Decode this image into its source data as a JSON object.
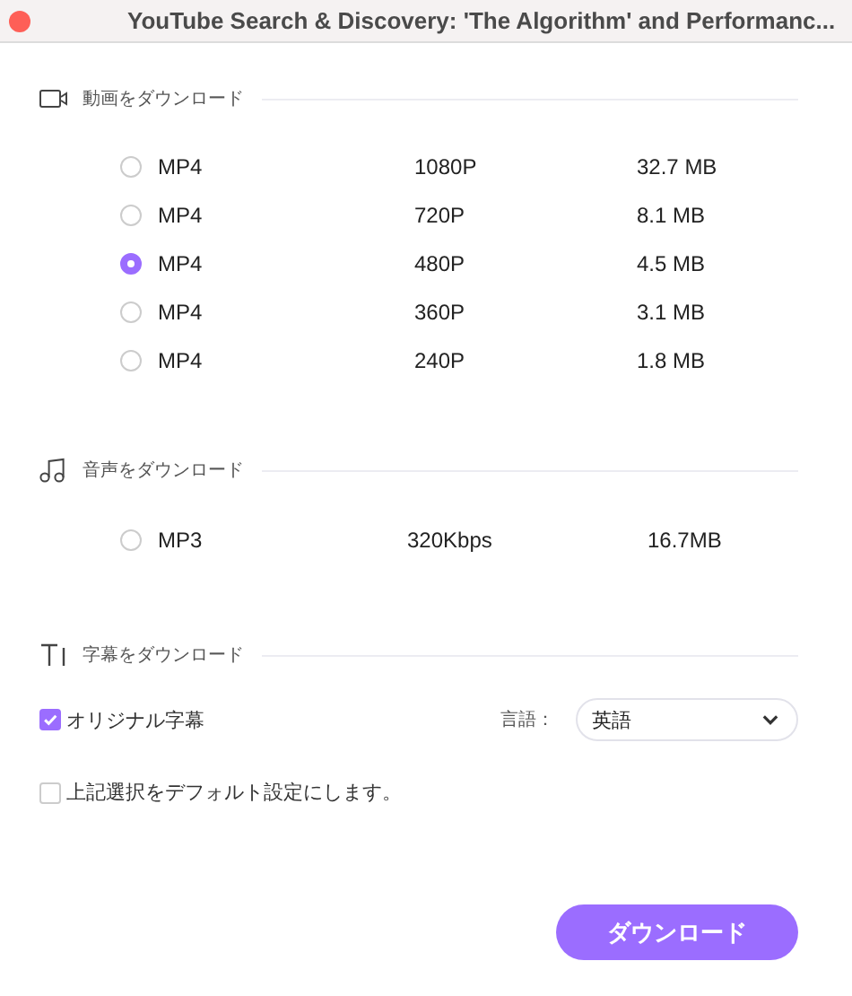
{
  "window": {
    "title": "YouTube Search & Discovery: 'The Algorithm' and Performanc..."
  },
  "sections": [
    {
      "kind": "video",
      "title": "動画をダウンロード",
      "options": [
        {
          "format": "MP4",
          "quality": "1080P",
          "size": "32.7 MB",
          "selected": false
        },
        {
          "format": "MP4",
          "quality": "720P",
          "size": "8.1 MB",
          "selected": false
        },
        {
          "format": "MP4",
          "quality": "480P",
          "size": "4.5 MB",
          "selected": true
        },
        {
          "format": "MP4",
          "quality": "360P",
          "size": "3.1 MB",
          "selected": false
        },
        {
          "format": "MP4",
          "quality": "240P",
          "size": "1.8 MB",
          "selected": false
        }
      ]
    },
    {
      "kind": "audio",
      "title": "音声をダウンロード",
      "options": [
        {
          "format": "MP3",
          "quality": "320Kbps",
          "size": "16.7MB",
          "selected": false
        }
      ]
    },
    {
      "kind": "subtitle",
      "title": "字幕をダウンロード"
    }
  ],
  "subtitles": {
    "label": "オリジナル字幕",
    "checked": true,
    "language_label": "言語：",
    "language": "英語"
  },
  "default_setting": {
    "label": "上記選択をデフォルト設定にします。",
    "checked": false
  },
  "download_button": "ダウンロード"
}
